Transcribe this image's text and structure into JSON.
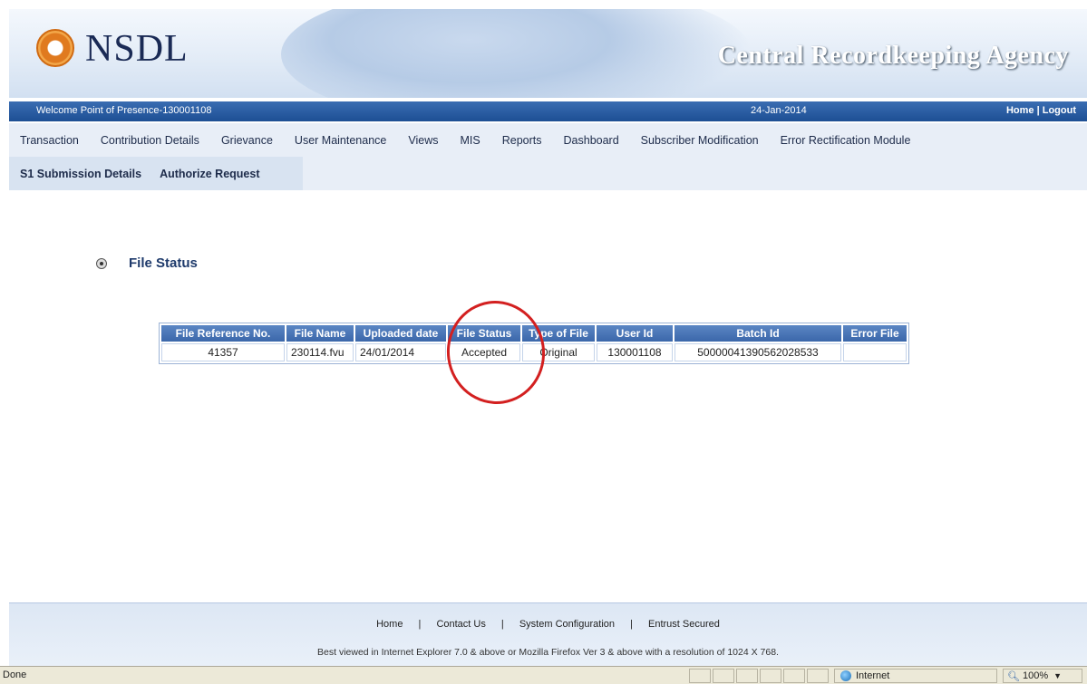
{
  "header": {
    "logo_text": "NSDL",
    "agency_title": "Central Recordkeeping Agency"
  },
  "welcome_bar": {
    "welcome": "Welcome Point of Presence-130001108",
    "date": "24-Jan-2014",
    "home": "Home",
    "separator": "|",
    "logout": "Logout"
  },
  "menu": {
    "items": [
      {
        "label": "Transaction"
      },
      {
        "label": "Contribution Details"
      },
      {
        "label": "Grievance"
      },
      {
        "label": "User Maintenance"
      },
      {
        "label": "Views"
      },
      {
        "label": "MIS"
      },
      {
        "label": "Reports"
      },
      {
        "label": "Dashboard"
      },
      {
        "label": "Subscriber Modification"
      },
      {
        "label": "Error Rectification Module"
      }
    ],
    "subitems": [
      {
        "label": "S1 Submission Details"
      },
      {
        "label": "Authorize Request"
      }
    ]
  },
  "content": {
    "section_title": "File Status",
    "table": {
      "headers": [
        "File Reference No.",
        "File Name",
        "Uploaded date",
        "File Status",
        "Type of File",
        "User Id",
        "Batch Id",
        "Error File"
      ],
      "rows": [
        [
          "41357",
          "230114.fvu",
          "24/01/2014",
          "Accepted",
          "Original",
          "130001108",
          "50000041390562028533",
          ""
        ]
      ]
    },
    "annotation_color": "#d32020"
  },
  "footer": {
    "links": [
      "Home",
      "Contact Us",
      "System Configuration",
      "Entrust Secured"
    ],
    "separator": "|",
    "note": "Best viewed in Internet Explorer 7.0 & above or Mozilla Firefox Ver 3 & above with a resolution of 1024 X 768."
  },
  "statusbar": {
    "done": "Done",
    "zone": "Internet",
    "zoom": "100%"
  },
  "colors": {
    "welcome_bar": "#1d4f94",
    "menu_bg": "#e8eef7",
    "title": "#1e3a6b"
  }
}
